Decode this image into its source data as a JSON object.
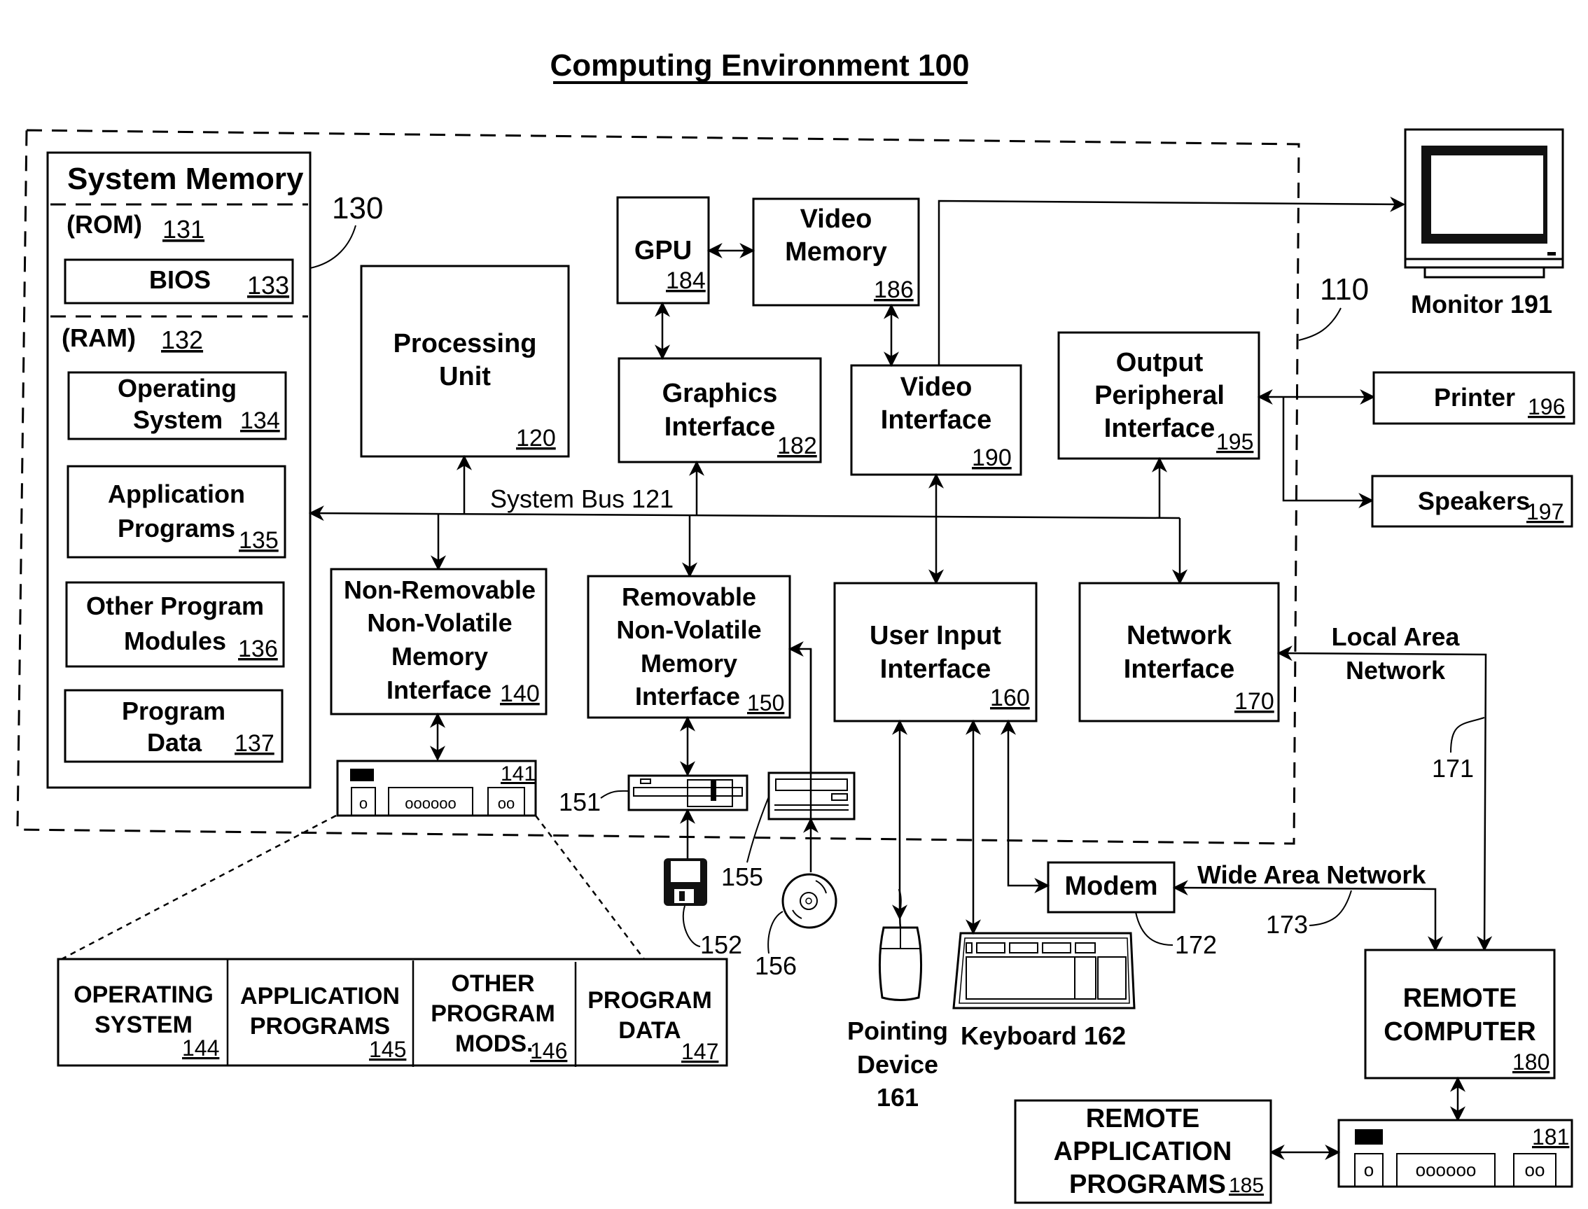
{
  "title": "Computing Environment 100",
  "environment_ref": "110",
  "system_memory": {
    "title": "System Memory",
    "ref": "130",
    "rom": {
      "label": "(ROM)",
      "ref": "131"
    },
    "bios": {
      "label": "BIOS",
      "ref": "133"
    },
    "ram": {
      "label": "(RAM)",
      "ref": "132"
    },
    "items": [
      {
        "line1": "Operating",
        "line2": "System",
        "ref": "134"
      },
      {
        "line1": "Application",
        "line2": "Programs",
        "ref": "135"
      },
      {
        "line1": "Other Program",
        "line2": "Modules",
        "ref": "136"
      },
      {
        "line1": "Program",
        "line2": "Data",
        "ref": "137"
      }
    ]
  },
  "processing_unit": {
    "line1": "Processing",
    "line2": "Unit",
    "ref": "120"
  },
  "gpu": {
    "label": "GPU",
    "ref": "184"
  },
  "video_memory": {
    "line1": "Video",
    "line2": "Memory",
    "ref": "186"
  },
  "graphics_interface": {
    "line1": "Graphics",
    "line2": "Interface",
    "ref": "182"
  },
  "video_interface": {
    "line1": "Video",
    "line2": "Interface",
    "ref": "190"
  },
  "output_peripheral": {
    "line1": "Output",
    "line2": "Peripheral",
    "line3": "Interface",
    "ref": "195"
  },
  "system_bus": {
    "label": "System Bus 121"
  },
  "non_removable": {
    "line1": "Non-Removable",
    "line2": "Non-Volatile",
    "line3": "Memory",
    "line4": "Interface",
    "ref": "140"
  },
  "removable": {
    "line1": "Removable",
    "line2": "Non-Volatile",
    "line3": "Memory",
    "line4": "Interface",
    "ref": "150"
  },
  "user_input": {
    "line1": "User Input",
    "line2": "Interface",
    "ref": "160"
  },
  "network_interface": {
    "line1": "Network",
    "line2": "Interface",
    "ref": "170"
  },
  "monitor": {
    "label": "Monitor 191"
  },
  "printer": {
    "label": "Printer",
    "ref": "196"
  },
  "speakers": {
    "label": "Speakers",
    "ref": "197"
  },
  "hard_disk": {
    "ref": "141",
    "slots": "oooooo",
    "small": "o",
    "pair": "oo"
  },
  "floppy_drive": {
    "ref": "151"
  },
  "floppy_disk": {
    "ref": "152"
  },
  "optical_drive": {
    "ref": "155"
  },
  "optical_disk": {
    "ref": "156"
  },
  "pointing_device": {
    "line1": "Pointing",
    "line2": "Device",
    "line3": "161"
  },
  "keyboard": {
    "label": "Keyboard 162"
  },
  "modem": {
    "label": "Modem",
    "ref": "172"
  },
  "lan": {
    "line1": "Local Area",
    "line2": "Network",
    "ref": "171"
  },
  "wan": {
    "label": "Wide Area Network",
    "ref": "173"
  },
  "remote_computer": {
    "line1": "REMOTE",
    "line2": "COMPUTER",
    "ref": "180"
  },
  "remote_storage": {
    "ref": "181",
    "slots": "oooooo",
    "small": "o",
    "pair": "oo"
  },
  "remote_apps": {
    "line1": "REMOTE",
    "line2": "APPLICATION",
    "line3": "PROGRAMS",
    "ref": "185"
  },
  "disk_contents": [
    {
      "line1": "OPERATING",
      "line2": "SYSTEM",
      "line3": "",
      "ref": "144"
    },
    {
      "line1": "APPLICATION",
      "line2": "PROGRAMS",
      "line3": "",
      "ref": "145"
    },
    {
      "line1": "OTHER",
      "line2": "PROGRAM",
      "line3": "MODS.",
      "ref": "146"
    },
    {
      "line1": "PROGRAM",
      "line2": "DATA",
      "line3": "",
      "ref": "147"
    }
  ]
}
